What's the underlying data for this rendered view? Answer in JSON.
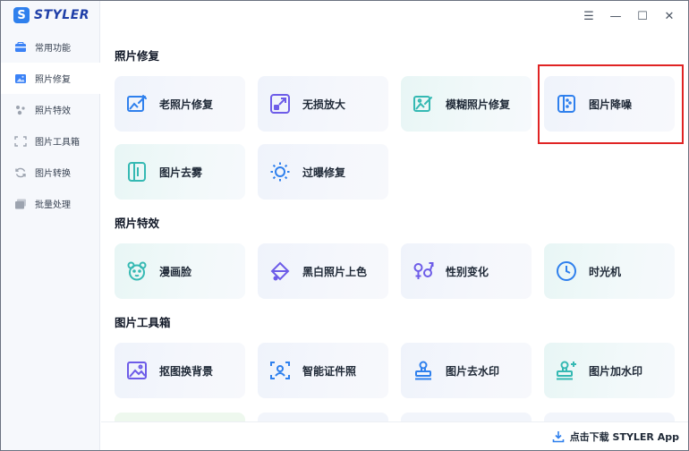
{
  "app": {
    "name": "STYLER",
    "logo_letter": "S"
  },
  "sidebar": {
    "items": [
      {
        "label": "常用功能",
        "icon": "toolbox-icon",
        "active": false
      },
      {
        "label": "照片修复",
        "icon": "image-repair-icon",
        "active": true
      },
      {
        "label": "照片特效",
        "icon": "sparkle-effects-icon",
        "active": false
      },
      {
        "label": "图片工具箱",
        "icon": "crop-tools-icon",
        "active": false
      },
      {
        "label": "图片转换",
        "icon": "convert-icon",
        "active": false
      },
      {
        "label": "批量处理",
        "icon": "batch-icon",
        "active": false
      }
    ]
  },
  "window_controls": {
    "menu": "☰",
    "minimize": "—",
    "maximize": "☐",
    "close": "✕"
  },
  "sections": {
    "repair": {
      "title": "照片修复",
      "cards": [
        {
          "label": "老照片修复",
          "icon": "old-photo-repair-icon"
        },
        {
          "label": "无损放大",
          "icon": "lossless-enlarge-icon"
        },
        {
          "label": "模糊照片修复",
          "icon": "blur-photo-repair-icon"
        },
        {
          "label": "图片降噪",
          "icon": "denoise-icon"
        },
        {
          "label": "图片去雾",
          "icon": "dehaze-icon"
        },
        {
          "label": "过曝修复",
          "icon": "overexposure-icon"
        }
      ]
    },
    "effects": {
      "title": "照片特效",
      "cards": [
        {
          "label": "漫画脸",
          "icon": "cartoon-face-icon"
        },
        {
          "label": "黑白照片上色",
          "icon": "colorize-icon"
        },
        {
          "label": "性别变化",
          "icon": "gender-swap-icon"
        },
        {
          "label": "时光机",
          "icon": "time-machine-icon"
        }
      ]
    },
    "toolbox": {
      "title": "图片工具箱",
      "cards": [
        {
          "label": "抠图换背景",
          "icon": "cutout-background-icon"
        },
        {
          "label": "智能证件照",
          "icon": "id-photo-icon"
        },
        {
          "label": "图片去水印",
          "icon": "remove-watermark-icon"
        },
        {
          "label": "图片加水印",
          "icon": "add-watermark-icon"
        }
      ]
    }
  },
  "footer": {
    "download_label": "点击下载 STYLER App"
  },
  "colors": {
    "accent": "#2f80ed",
    "purple": "#6d5ce8",
    "teal": "#35b9b3",
    "highlight": "#e02424"
  }
}
